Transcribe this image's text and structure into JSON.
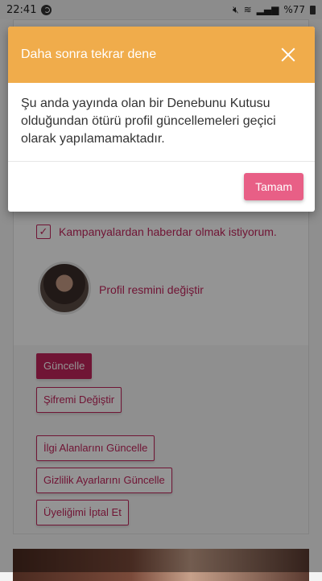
{
  "status_bar": {
    "time": "22:41",
    "battery": "%77",
    "icons": [
      "mute-icon",
      "wifi-icon",
      "signal-icon",
      "battery-icon"
    ]
  },
  "page": {
    "newsletter_label": "Kampanyalardan haberdar olmak istiyorum.",
    "newsletter_checked": true,
    "change_photo_label": "Profil resmini değiştir",
    "buttons": {
      "update": "Güncelle",
      "change_password": "Şifremi Değiştir",
      "update_interests": "İlgi Alanlarını Güncelle",
      "update_privacy": "Gizlilik Ayarlarını Güncelle",
      "cancel_membership": "Üyeliğimi İptal Et"
    }
  },
  "modal": {
    "title": "Daha sonra tekrar dene",
    "message": "Şu anda yayında olan bir Denebunu Kutusu olduğundan ötürü profil güncellemeleri geçici olarak yapılamamaktadır.",
    "ok_label": "Tamam"
  },
  "colors": {
    "accent": "#c2255c",
    "modal_header": "#f0ac4b",
    "ok_button": "#e85f86"
  }
}
